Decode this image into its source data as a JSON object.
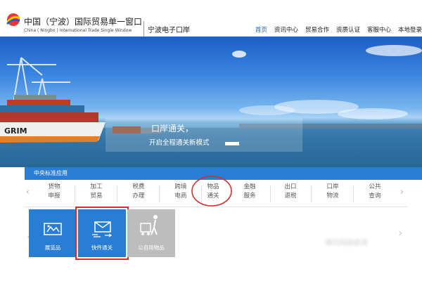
{
  "header": {
    "logo_cn": "中国（宁波）国际贸易单一窗口",
    "logo_en": "China ( Ningbo ) International Trade Single Window",
    "logo_sub": "宁波电子口岸",
    "nav": [
      "首页",
      "资讯中心",
      "贸易合作",
      "资质认证",
      "客服中心",
      "本地登录"
    ]
  },
  "banner": {
    "slogan_line1": "口岸通关，",
    "slogan_line2": "开启全程通关新模式",
    "ship_text": "GRIM"
  },
  "tabs": {
    "label": "中央标准应用"
  },
  "categories": [
    {
      "line1": "货物",
      "line2": "申报"
    },
    {
      "line1": "加工",
      "line2": "贸易"
    },
    {
      "line1": "税费",
      "line2": "办理"
    },
    {
      "line1": "跨境",
      "line2": "电商"
    },
    {
      "line1": "物品",
      "line2": "通关"
    },
    {
      "line1": "金融",
      "line2": "服务"
    },
    {
      "line1": "出口",
      "line2": "退税"
    },
    {
      "line1": "口岸",
      "line2": "物流"
    },
    {
      "line1": "公共",
      "line2": "查询"
    }
  ],
  "tiles": [
    {
      "label": "展览品"
    },
    {
      "label": "快件通关"
    },
    {
      "label": "公自用物品"
    }
  ],
  "blurred_text": "腾讯网易新闻",
  "colors": {
    "accent": "#2a7dd4",
    "nav_active": "#1565c0",
    "highlight_red": "#d32f2f",
    "tile_blue": "#2a7dd4",
    "tile_grey": "#bdbdbd"
  }
}
